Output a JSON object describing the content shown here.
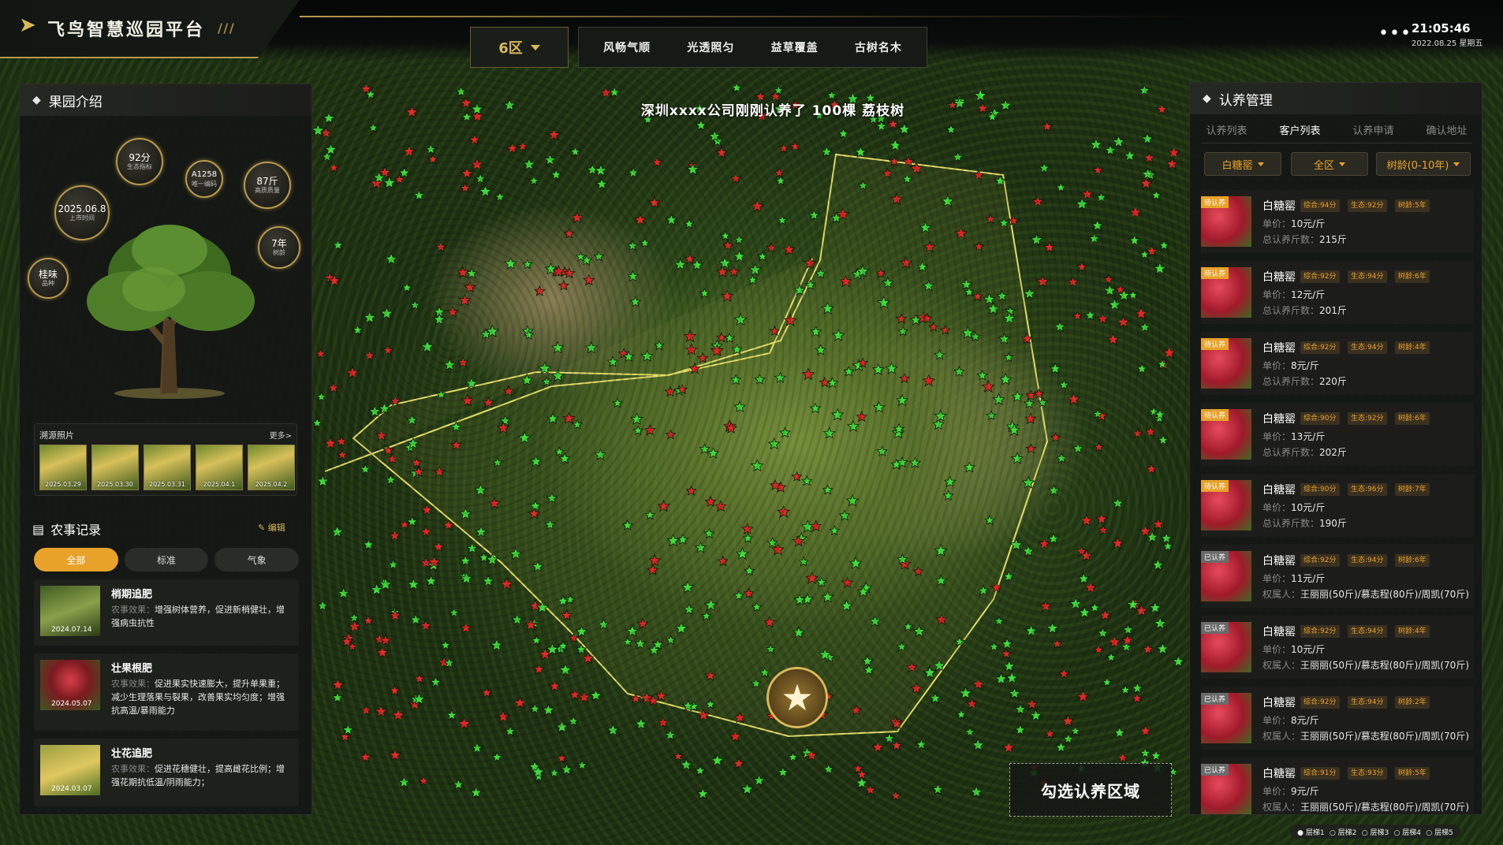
{
  "header": {
    "brand": "飞鸟智慧巡园平台",
    "zone": "6区",
    "nav": [
      "风畅气顺",
      "光透照匀",
      "益草覆盖",
      "古树名木"
    ],
    "time": "21:05:46",
    "date": "2022.08.25 星期五"
  },
  "intro": {
    "title": "果园介绍",
    "stats": [
      {
        "value": "92分",
        "label": "生态指标"
      },
      {
        "value": "A1258",
        "label": "唯一编码"
      },
      {
        "value": "87斤",
        "label": "高质质量"
      },
      {
        "value": "2025.06.8",
        "label": "上市时间"
      },
      {
        "value": "7年",
        "label": "树龄"
      },
      {
        "value": "桂味",
        "label": "品种"
      }
    ],
    "photos_title": "溯源照片",
    "photos_more": "更多>",
    "photos": [
      "2025.03.29",
      "2025.03.30",
      "2025.03.31",
      "2025.04.1",
      "2025.04.2"
    ]
  },
  "farm": {
    "title": "农事记录",
    "edit": "编辑",
    "filters": [
      "全部",
      "标准",
      "气象"
    ],
    "effect_label": "农事效果：",
    "records": [
      {
        "title": "梢期追肥",
        "date": "2024.07.14",
        "desc": "增强树体营养，促进新梢健壮，增强病虫抗性"
      },
      {
        "title": "壮果根肥",
        "date": "2024.05.07",
        "desc": "促进果实快速膨大，提升单果重；减少生理落果与裂果，改善果实均匀度；增强抗高温/暴雨能力"
      },
      {
        "title": "壮花追肥",
        "date": "2024.03.07",
        "desc": "促进花穗健壮，提高雌花比例；增强花期抗低温/阴雨能力；"
      }
    ]
  },
  "map": {
    "banner": "深圳xxxx公司刚刚认养了  100棵  荔枝树",
    "select_label": "勾选认养区域",
    "legend": [
      "● 层梯1",
      "○ 层梯2",
      "○ 层梯3",
      "○ 层梯4",
      "○ 层梯5"
    ]
  },
  "adopt": {
    "title": "认养管理",
    "tabs": [
      "认养列表",
      "客户列表",
      "认养申请",
      "确认地址"
    ],
    "selects": [
      "白糖罂",
      "全区",
      "树龄(0-10年)"
    ],
    "price_label": "单价：",
    "total_label": "总认养斤数：",
    "owner_label": "权属人：",
    "items": [
      {
        "badge": "待认养",
        "name": "白糖罂",
        "score": "综合:94分",
        "eco": "生态:92分",
        "age": "树龄:5年",
        "price": "10元/斤",
        "extra": "215斤"
      },
      {
        "badge": "待认养",
        "name": "白糖罂",
        "score": "综合:92分",
        "eco": "生态:94分",
        "age": "树龄:6年",
        "price": "12元/斤",
        "extra": "201斤"
      },
      {
        "badge": "待认养",
        "name": "白糖罂",
        "score": "综合:92分",
        "eco": "生态:94分",
        "age": "树龄:4年",
        "price": "8元/斤",
        "extra": "220斤"
      },
      {
        "badge": "待认养",
        "name": "白糖罂",
        "score": "综合:90分",
        "eco": "生态:92分",
        "age": "树龄:6年",
        "price": "13元/斤",
        "extra": "202斤"
      },
      {
        "badge": "待认养",
        "name": "白糖罂",
        "score": "综合:90分",
        "eco": "生态:96分",
        "age": "树龄:7年",
        "price": "10元/斤",
        "extra": "190斤"
      },
      {
        "badge": "已认养",
        "name": "白糖罂",
        "score": "综合:92分",
        "eco": "生态:94分",
        "age": "树龄:6年",
        "price": "11元/斤",
        "extra": "王丽丽(50斤)/慕志程(80斤)/周凯(70斤)"
      },
      {
        "badge": "已认养",
        "name": "白糖罂",
        "score": "综合:92分",
        "eco": "生态:94分",
        "age": "树龄:4年",
        "price": "10元/斤",
        "extra": "王丽丽(50斤)/慕志程(80斤)/周凯(70斤)"
      },
      {
        "badge": "已认养",
        "name": "白糖罂",
        "score": "综合:92分",
        "eco": "生态:94分",
        "age": "树龄:2年",
        "price": "8元/斤",
        "extra": "王丽丽(50斤)/慕志程(80斤)/周凯(70斤)"
      },
      {
        "badge": "已认养",
        "name": "白糖罂",
        "score": "综合:91分",
        "eco": "生态:93分",
        "age": "树龄:5年",
        "price": "9元/斤",
        "extra": "王丽丽(50斤)/慕志程(80斤)/周凯(70斤)"
      }
    ]
  },
  "colors": {
    "accent": "#e8a22a",
    "gold": "#b89a4c",
    "star_green": "#3fdc3a",
    "star_red": "#e02424",
    "region": "#e6dd6a"
  }
}
